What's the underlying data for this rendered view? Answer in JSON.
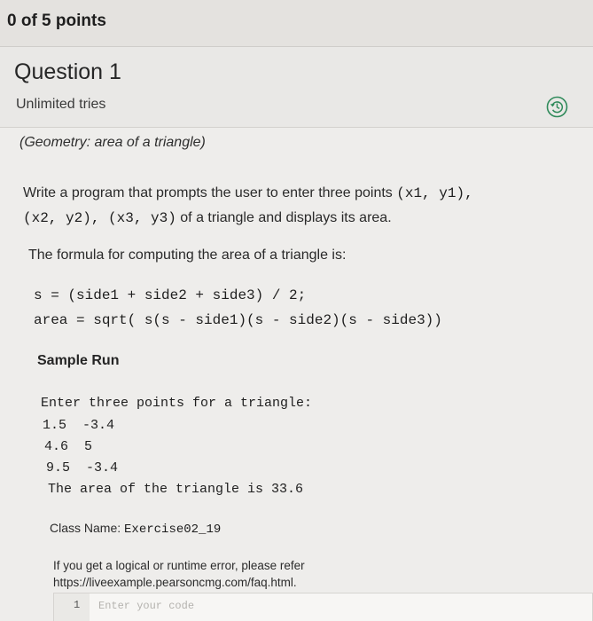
{
  "score": "0 of 5 points",
  "question": {
    "title": "Question 1",
    "tries": "Unlimited tries",
    "history_icon": "history-icon"
  },
  "problem": {
    "subtitle": "(Geometry: area of a triangle)",
    "desc_part1": "Write a program that prompts the user to enter three points ",
    "desc_code1": "(x1, y1),",
    "desc_code2": "(x2, y2), (x3, y3)",
    "desc_part2": " of a triangle and displays its area.",
    "formula_intro": "The formula for computing the area of a triangle is:",
    "formula_lines": [
      "s = (side1 + side2 + side3) / 2;",
      "area = sqrt( s(s - side1)(s - side2)(s - side3))"
    ]
  },
  "sample_run": {
    "title": "Sample Run",
    "prompt": "Enter three points for a triangle:",
    "inputs": [
      "1.5  -3.4",
      "4.6  5",
      "9.5  -3.4"
    ],
    "result": "The area of the triangle is 33.6"
  },
  "class_name": {
    "label": "Class Name: ",
    "value": "Exercise02_19"
  },
  "error_note": {
    "line1": "If you get a logical or runtime error, please refer",
    "line2": "https://liveexample.pearsoncmg.com/faq.html."
  },
  "editor": {
    "line_number": "1",
    "placeholder": "Enter your code",
    "value": ""
  }
}
